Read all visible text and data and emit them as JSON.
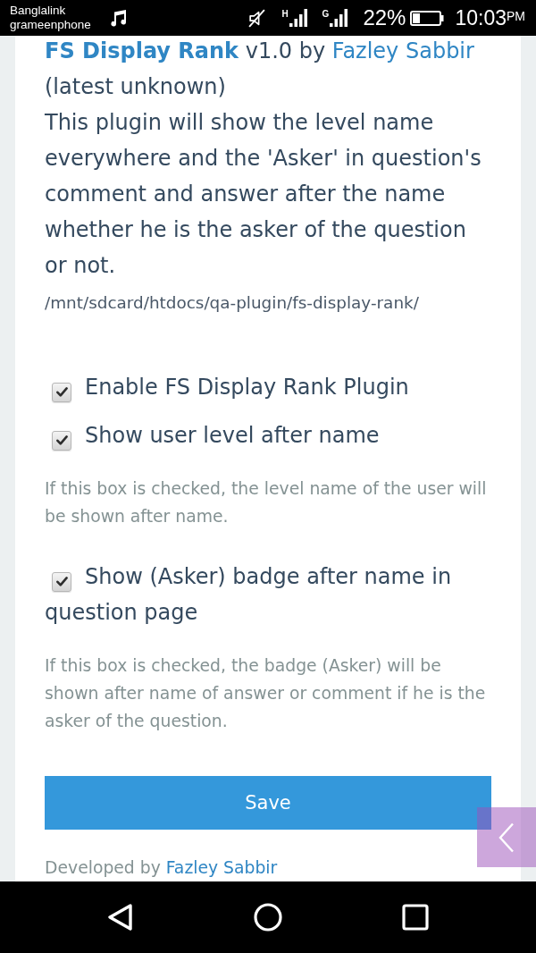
{
  "status_bar": {
    "carriers": [
      "Banglalink",
      "grameenphone"
    ],
    "network_types": [
      "H",
      "G"
    ],
    "battery": "22%",
    "time": "10:03",
    "meridiem": "PM"
  },
  "plugin": {
    "title": "FS Display Rank",
    "version": "v1.0 by",
    "author": "Fazley Sabbir",
    "latest": "(latest unknown)",
    "description": "This plugin will show the level name everywhere and the 'Asker' in question's comment and answer after the name whether he is the asker of the question or not.",
    "path": "/mnt/sdcard/htdocs/qa-plugin/fs-display-rank/"
  },
  "options": [
    {
      "label": "Enable FS Display Rank Plugin",
      "checked": true
    },
    {
      "label": "Show user level after name",
      "checked": true,
      "note": "If this box is checked, the level name of the user will be shown after name."
    },
    {
      "label": "Show (Asker) badge after name in question page",
      "checked": true,
      "note": "If this box is checked, the badge (Asker) will be shown after name of answer or comment if he is the asker of the question."
    }
  ],
  "save_button": "Save",
  "footer": {
    "text": "Developed by",
    "author": "Fazley Sabbir"
  }
}
